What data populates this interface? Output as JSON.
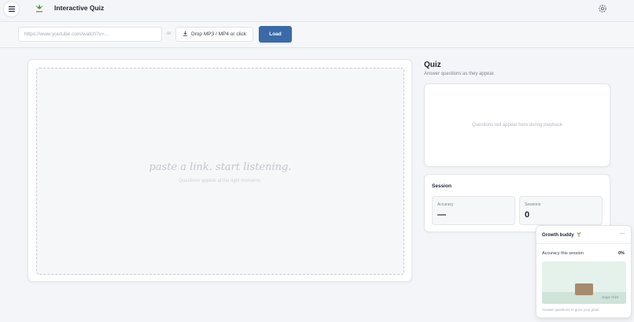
{
  "header": {
    "app_title": "Interactive Quiz",
    "menu_icon": "hamburger-menu-icon",
    "logo_icon": "plant-logo-icon",
    "settings_icon": "gear-icon"
  },
  "loadbar": {
    "url_placeholder": "https://www.youtube.com/watch?v=...",
    "or_text": "or",
    "drop_label": "Drop MP3 / MP4 or click",
    "drop_icon": "download-icon",
    "load_label": "Load"
  },
  "player": {
    "placeholder_main": "paste a link. start listening.",
    "placeholder_sub": "Questions appear at the right moments."
  },
  "quiz": {
    "title": "Quiz",
    "subtitle": "Answer questions as they appear.",
    "empty_text": "Questions will appear here during playback"
  },
  "session": {
    "title": "Session",
    "accuracy_label": "Accuracy",
    "accuracy_value": "—",
    "sessions_label": "Sessions",
    "sessions_value": "0"
  },
  "buddy": {
    "title": "Growth buddy",
    "title_icon": "seedling-icon",
    "minimize_label": "—",
    "accuracy_label": "Accuracy this session",
    "accuracy_value": "0%",
    "stage_label": "stage 0/10",
    "hint": "Answer questions to grow your plant."
  },
  "colors": {
    "accent": "#3a6aa8",
    "background": "#f4f5f8",
    "plant_bg": "#e5f2ec",
    "pot": "#a78b6c"
  }
}
